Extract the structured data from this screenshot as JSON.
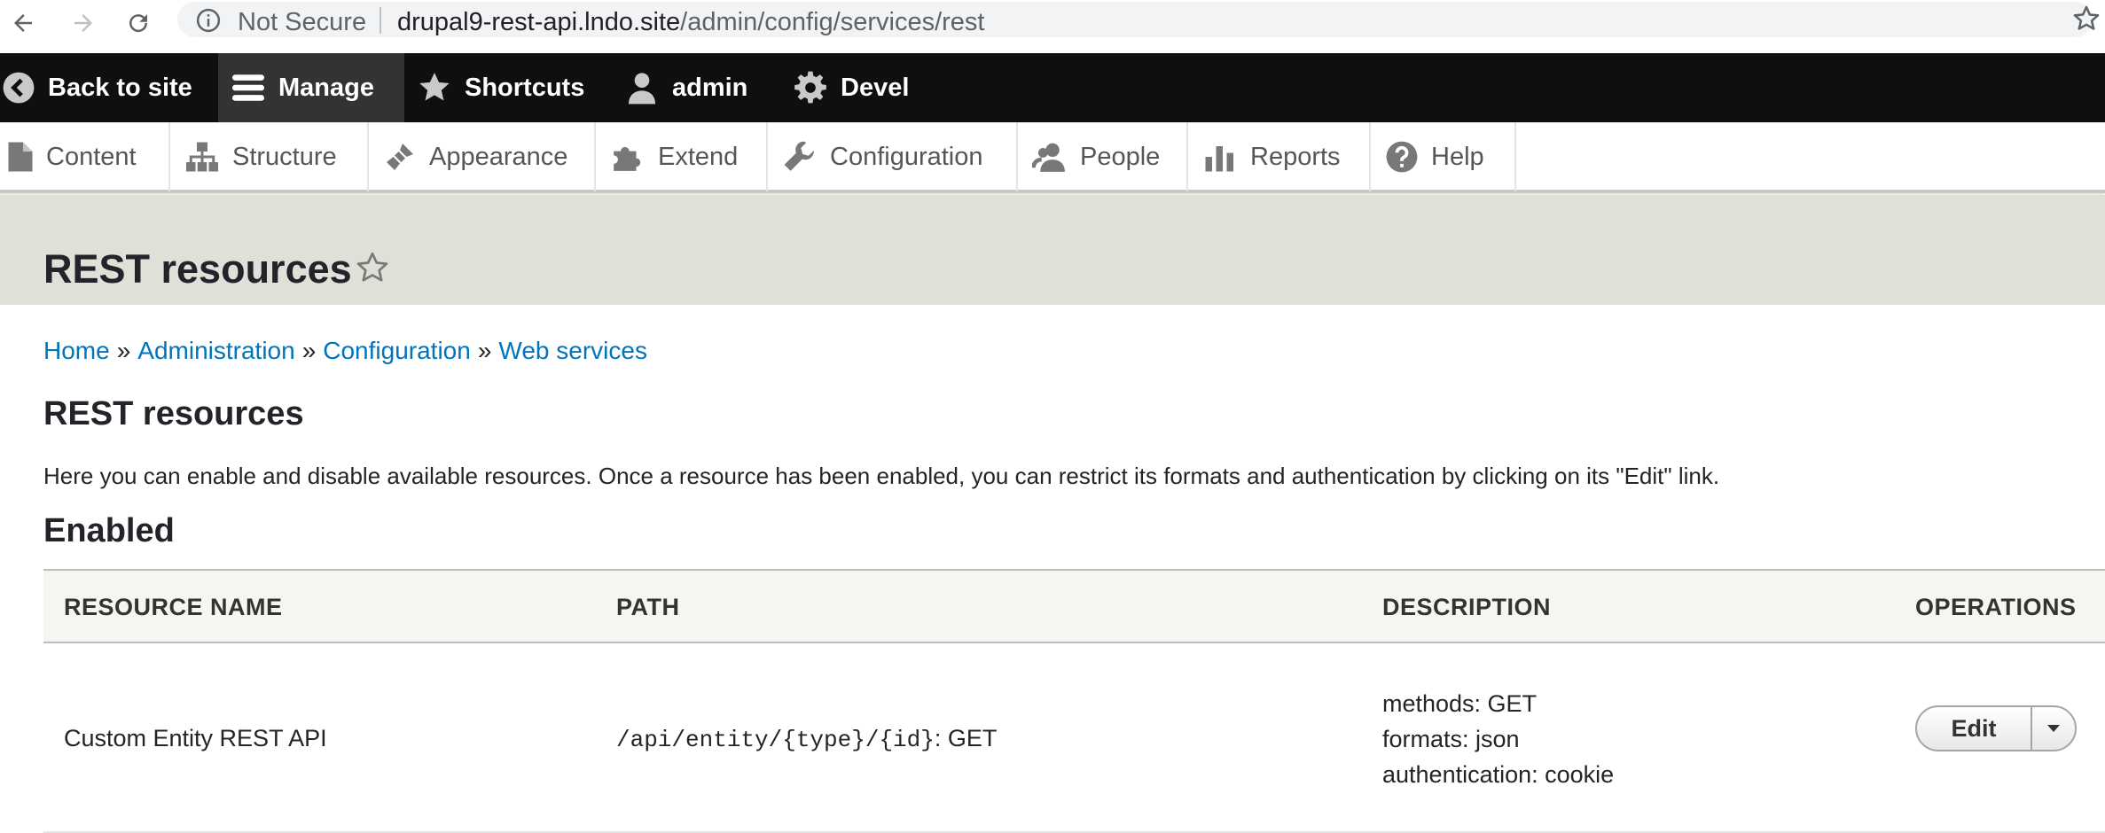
{
  "browser": {
    "security_label": "Not Secure",
    "url_host": "drupal9-rest-api.lndo.site",
    "url_path": "/admin/config/services/rest"
  },
  "toolbar": {
    "items": [
      {
        "label": "Back to site",
        "icon": "chevron-left-circle-icon"
      },
      {
        "label": "Manage",
        "icon": "menu-icon"
      },
      {
        "label": "Shortcuts",
        "icon": "star-icon"
      },
      {
        "label": "admin",
        "icon": "user-icon"
      },
      {
        "label": "Devel",
        "icon": "gear-icon"
      }
    ]
  },
  "tray": {
    "items": [
      {
        "label": "Content",
        "icon": "file-icon"
      },
      {
        "label": "Structure",
        "icon": "sitemap-icon"
      },
      {
        "label": "Appearance",
        "icon": "paintbrush-icon"
      },
      {
        "label": "Extend",
        "icon": "puzzle-icon"
      },
      {
        "label": "Configuration",
        "icon": "wrench-icon"
      },
      {
        "label": "People",
        "icon": "people-icon"
      },
      {
        "label": "Reports",
        "icon": "bar-chart-icon"
      },
      {
        "label": "Help",
        "icon": "help-icon"
      }
    ]
  },
  "page": {
    "title": "REST resources",
    "breadcrumb": [
      "Home",
      "Administration",
      "Configuration",
      "Web services"
    ],
    "breadcrumb_separator": "»",
    "section_title": "REST resources",
    "intro": "Here you can enable and disable available resources. Once a resource has been enabled, you can restrict its formats and authentication by clicking on its \"Edit\" link.",
    "enabled_title": "Enabled"
  },
  "table": {
    "headers": [
      "RESOURCE NAME",
      "PATH",
      "DESCRIPTION",
      "OPERATIONS"
    ],
    "rows": [
      {
        "name": "Custom Entity REST API",
        "path_code": "/api/entity/{type}/{id}",
        "path_method": ": GET",
        "description": [
          "methods: GET",
          "formats: json",
          "authentication: cookie"
        ],
        "operation": "Edit"
      }
    ]
  },
  "colors": {
    "toolbar_bg": "#0f0f0f",
    "header_bg": "#e0e0d8",
    "link": "#0074bd"
  }
}
